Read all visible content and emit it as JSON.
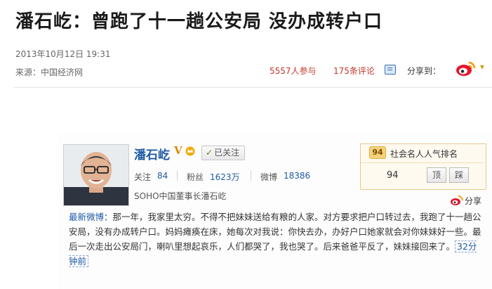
{
  "article": {
    "headline": "潘石屹：曾跑了十一趟公安局 没办成转户口",
    "datetime": "2013年10月12日  19:31",
    "source": "来源：中国经济网",
    "participants": "5557人参与",
    "comments": "175条评论",
    "share_label": "分享到：",
    "share_more": "▾"
  },
  "weibo": {
    "user_name": "潘石屹",
    "vip_badge": "V",
    "followed_label": "已关注",
    "followed_check": "✓",
    "stats": [
      {
        "label": "关注",
        "value": "84"
      },
      {
        "label": "粉丝",
        "value": "1623万"
      },
      {
        "label": "微博",
        "value": "18386"
      }
    ],
    "bio": "SOHO中国董事长潘石屹",
    "rank": {
      "badge": "94",
      "title": "社会名人人气排名",
      "value": "94",
      "top_label": "顶",
      "down_label": "踩"
    },
    "share_label": "分享",
    "post": {
      "lead": "最新微博：",
      "body": "那一年，我家里太穷。不得不把妹妹送给有粮的人家。对方要求把户口转过去，我跑了十一趟公安局，没有办成转户口。妈妈瘫痪在床，她每次对我说：你快去办，办好户口她家就会对你妹妹好一些。最后一次走出公安局门，喇叭里想起哀乐，人们都哭了，我也哭了。后来爸爸平反了，妹妹接回来了。",
      "time": "32分钟前"
    }
  },
  "colors": {
    "link_red": "#c0392b",
    "weibo_blue": "#1f5aa6"
  }
}
